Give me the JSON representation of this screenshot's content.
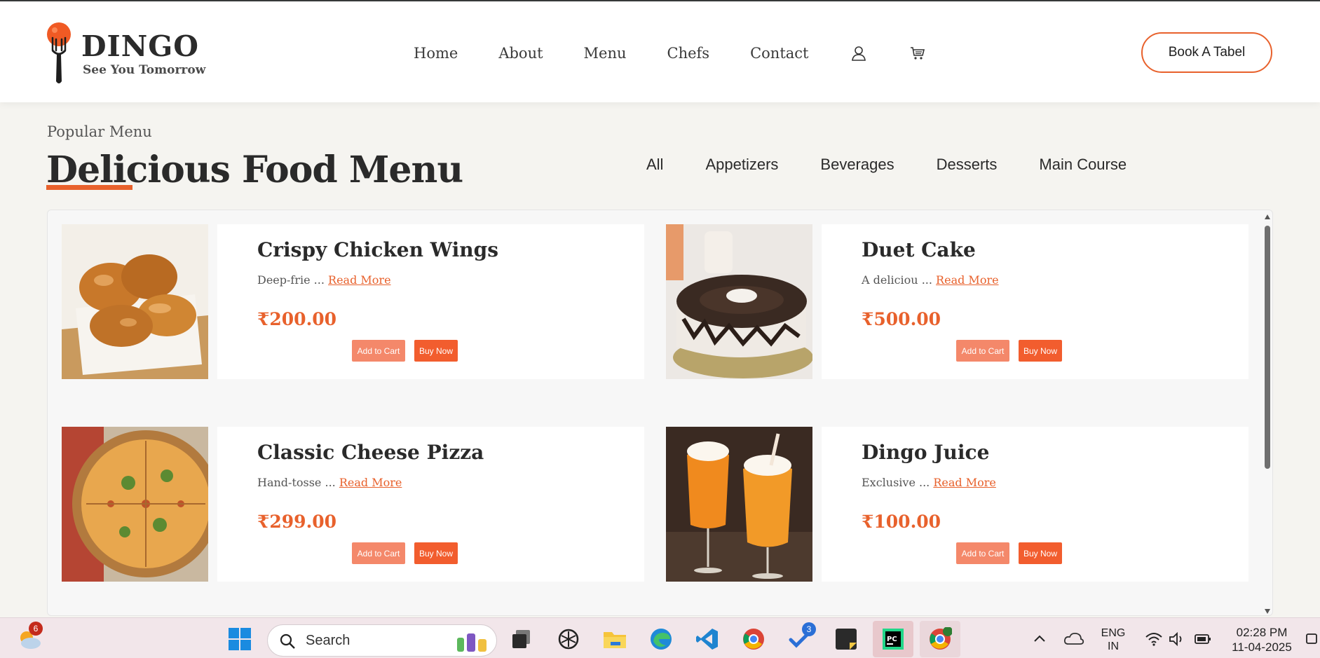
{
  "header": {
    "brand_name": "DINGO",
    "brand_tagline": "See You Tomorrow",
    "nav_items": [
      "Home",
      "About",
      "Menu",
      "Chefs",
      "Contact"
    ],
    "user_icon": "user-icon",
    "cart_icon": "cart-icon",
    "book_button": "Book A Tabel"
  },
  "section": {
    "eyebrow": "Popular Menu",
    "title": "Delicious Food Menu",
    "filters": [
      "All",
      "Appetizers",
      "Beverages",
      "Desserts",
      "Main Course"
    ]
  },
  "menu": {
    "items": [
      {
        "name": "Crispy Chicken Wings",
        "desc": "Deep-frie ...",
        "read_more": "Read More",
        "price": "₹200.00",
        "add_to_cart": "Add to Cart",
        "buy_now": "Buy Now",
        "image": "fried-chicken-image"
      },
      {
        "name": "Duet Cake",
        "desc": "A deliciou ...",
        "read_more": "Read More",
        "price": "₹500.00",
        "add_to_cart": "Add to Cart",
        "buy_now": "Buy Now",
        "image": "cake-image"
      },
      {
        "name": "Classic Cheese Pizza",
        "desc": "Hand-tosse ...",
        "read_more": "Read More",
        "price": "₹299.00",
        "add_to_cart": "Add to Cart",
        "buy_now": "Buy Now",
        "image": "pizza-image"
      },
      {
        "name": "Dingo Juice",
        "desc": "Exclusive ...",
        "read_more": "Read More",
        "price": "₹100.00",
        "add_to_cart": "Add to Cart",
        "buy_now": "Buy Now",
        "image": "juice-image"
      }
    ]
  },
  "taskbar": {
    "weather_badge": "6",
    "search_placeholder": "Search",
    "todo_badge": "3",
    "language_top": "ENG",
    "language_bottom": "IN",
    "time": "02:28 PM",
    "date": "11-04-2025"
  },
  "colors": {
    "accent": "#e8612c",
    "add_to_cart": "#f4886a",
    "buy_now": "#f25d2e"
  }
}
